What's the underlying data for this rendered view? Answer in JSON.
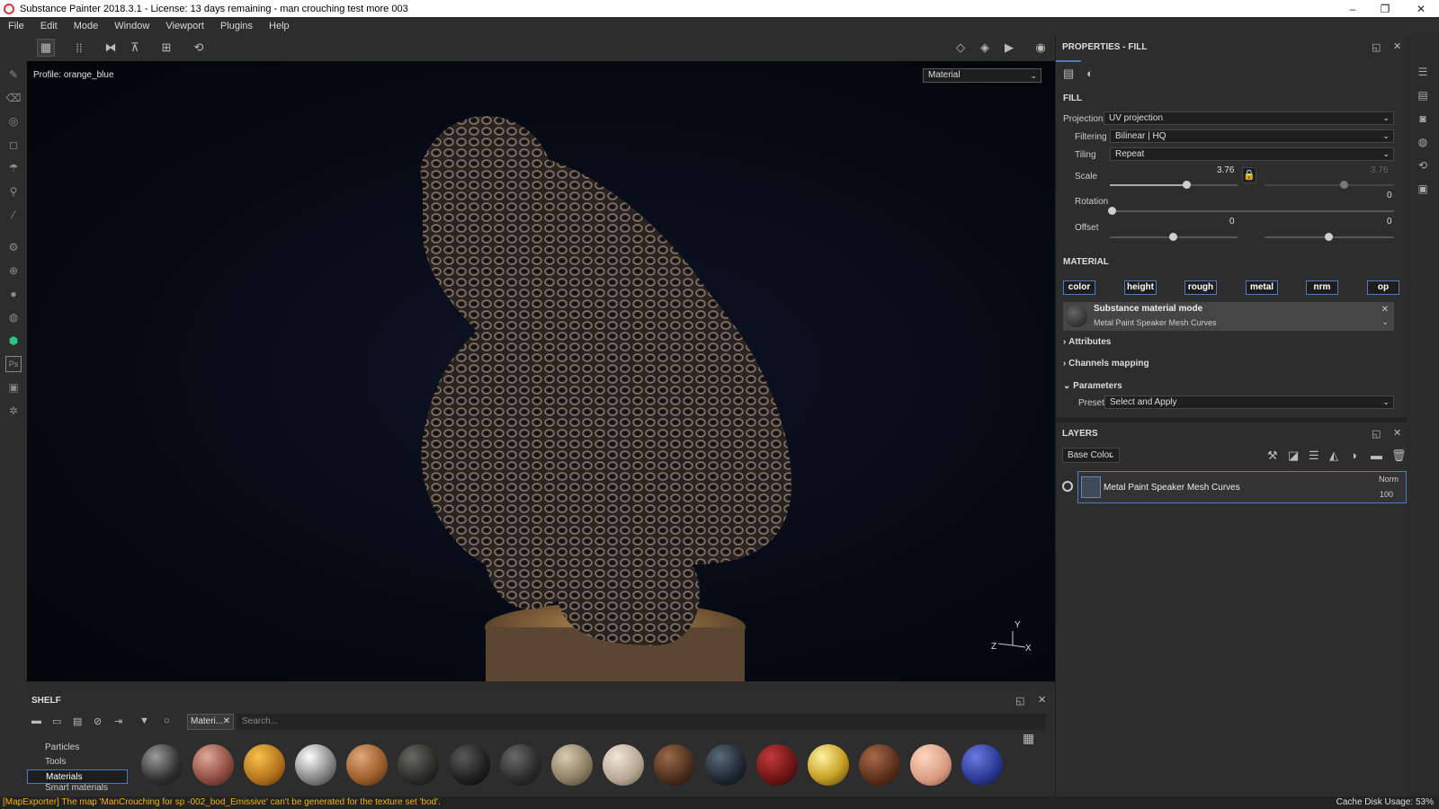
{
  "window": {
    "title": "Substance Painter 2018.3.1 - License: 13 days remaining - man crouching test more 003",
    "minimize": "–",
    "maximize": "❐",
    "close": "✕"
  },
  "menu": [
    "File",
    "Edit",
    "Mode",
    "Window",
    "Viewport",
    "Plugins",
    "Help"
  ],
  "viewport": {
    "profile": "Profile: orange_blue",
    "mode": "Material",
    "axis_y": "Y",
    "axis_z": "Z",
    "axis_x": "X"
  },
  "properties": {
    "title": "PROPERTIES - FILL",
    "fill_header": "FILL",
    "projection_label": "Projection",
    "projection_value": "UV projection",
    "filtering_label": "Filtering",
    "filtering_value": "Bilinear | HQ",
    "tiling_label": "Tiling",
    "tiling_value": "Repeat",
    "scale_label": "Scale",
    "scale_value": "3.76",
    "scale_value2": "3.76",
    "scale_fraction": 0.6,
    "rotation_label": "Rotation",
    "rotation_value": "0",
    "offset_label": "Offset",
    "offset_value_u": "0",
    "offset_value_v": "0",
    "material_header": "MATERIAL",
    "channels": [
      "color",
      "height",
      "rough",
      "metal",
      "nrm",
      "op"
    ],
    "substance_mode_title": "Substance material mode",
    "substance_mode_material": "Metal Paint Speaker Mesh Curves",
    "attributes": "Attributes",
    "channels_mapping": "Channels mapping",
    "parameters": "Parameters",
    "preset_label": "Preset",
    "preset_value": "Select and Apply"
  },
  "layers": {
    "title": "LAYERS",
    "channel": "Base Color",
    "items": [
      {
        "name": "Metal Paint Speaker Mesh Curves",
        "blend": "Norm",
        "opacity": "100"
      }
    ]
  },
  "shelf": {
    "title": "SHELF",
    "filter_tag": "Materi...",
    "search_placeholder": "Search...",
    "categories": [
      "Particles",
      "Tools",
      "Materials",
      "Smart materials"
    ],
    "selected_category": "Materials"
  },
  "status": {
    "message": "[MapExporter] The map 'ManCrouching for sp -002_bod_Emissive' can't be generated for the texture set 'bod'.",
    "cache": "Cache Disk Usage:   53%"
  },
  "colors": {
    "accent": "#4c7bc2",
    "status_warning": "#f0b400",
    "panel_bg": "#2d2d2d"
  }
}
